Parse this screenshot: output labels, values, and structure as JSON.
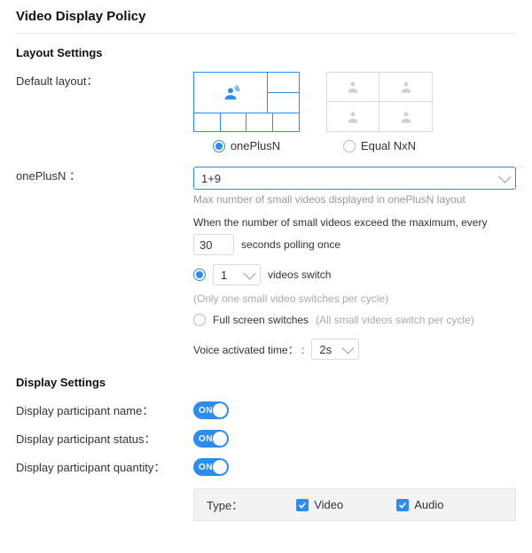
{
  "page_title": "Video Display Policy",
  "layout_section": {
    "title": "Layout Settings",
    "default_layout_label": "Default layout：",
    "options": {
      "oneplusn": "onePlusN",
      "equalnxn": "Equal NxN",
      "selected": "oneplusn"
    },
    "oneplusn_label": "onePlusN ：",
    "select_value": "1+9",
    "select_hint": "Max number of small videos displayed in onePlusN layout",
    "exceed_text": "When the number of small videos exceed the maximum, every",
    "polling_seconds": "30",
    "polling_suffix": "seconds polling once",
    "switch_count": "1",
    "switch_videos_label": "videos switch",
    "switch_videos_hint": "(Only one small video switches per cycle)",
    "full_switch_label": "Full screen switches",
    "full_switch_hint": "(All small videos switch per cycle)",
    "voice_label": "Voice activated time： :",
    "voice_value": "2s"
  },
  "display_section": {
    "title": "Display Settings",
    "name_label": "Display participant name：",
    "status_label": "Display participant status：",
    "quantity_label": "Display participant quantity：",
    "toggle_on": "ON",
    "type_label": "Type：",
    "type_video": "Video",
    "type_audio": "Audio"
  }
}
